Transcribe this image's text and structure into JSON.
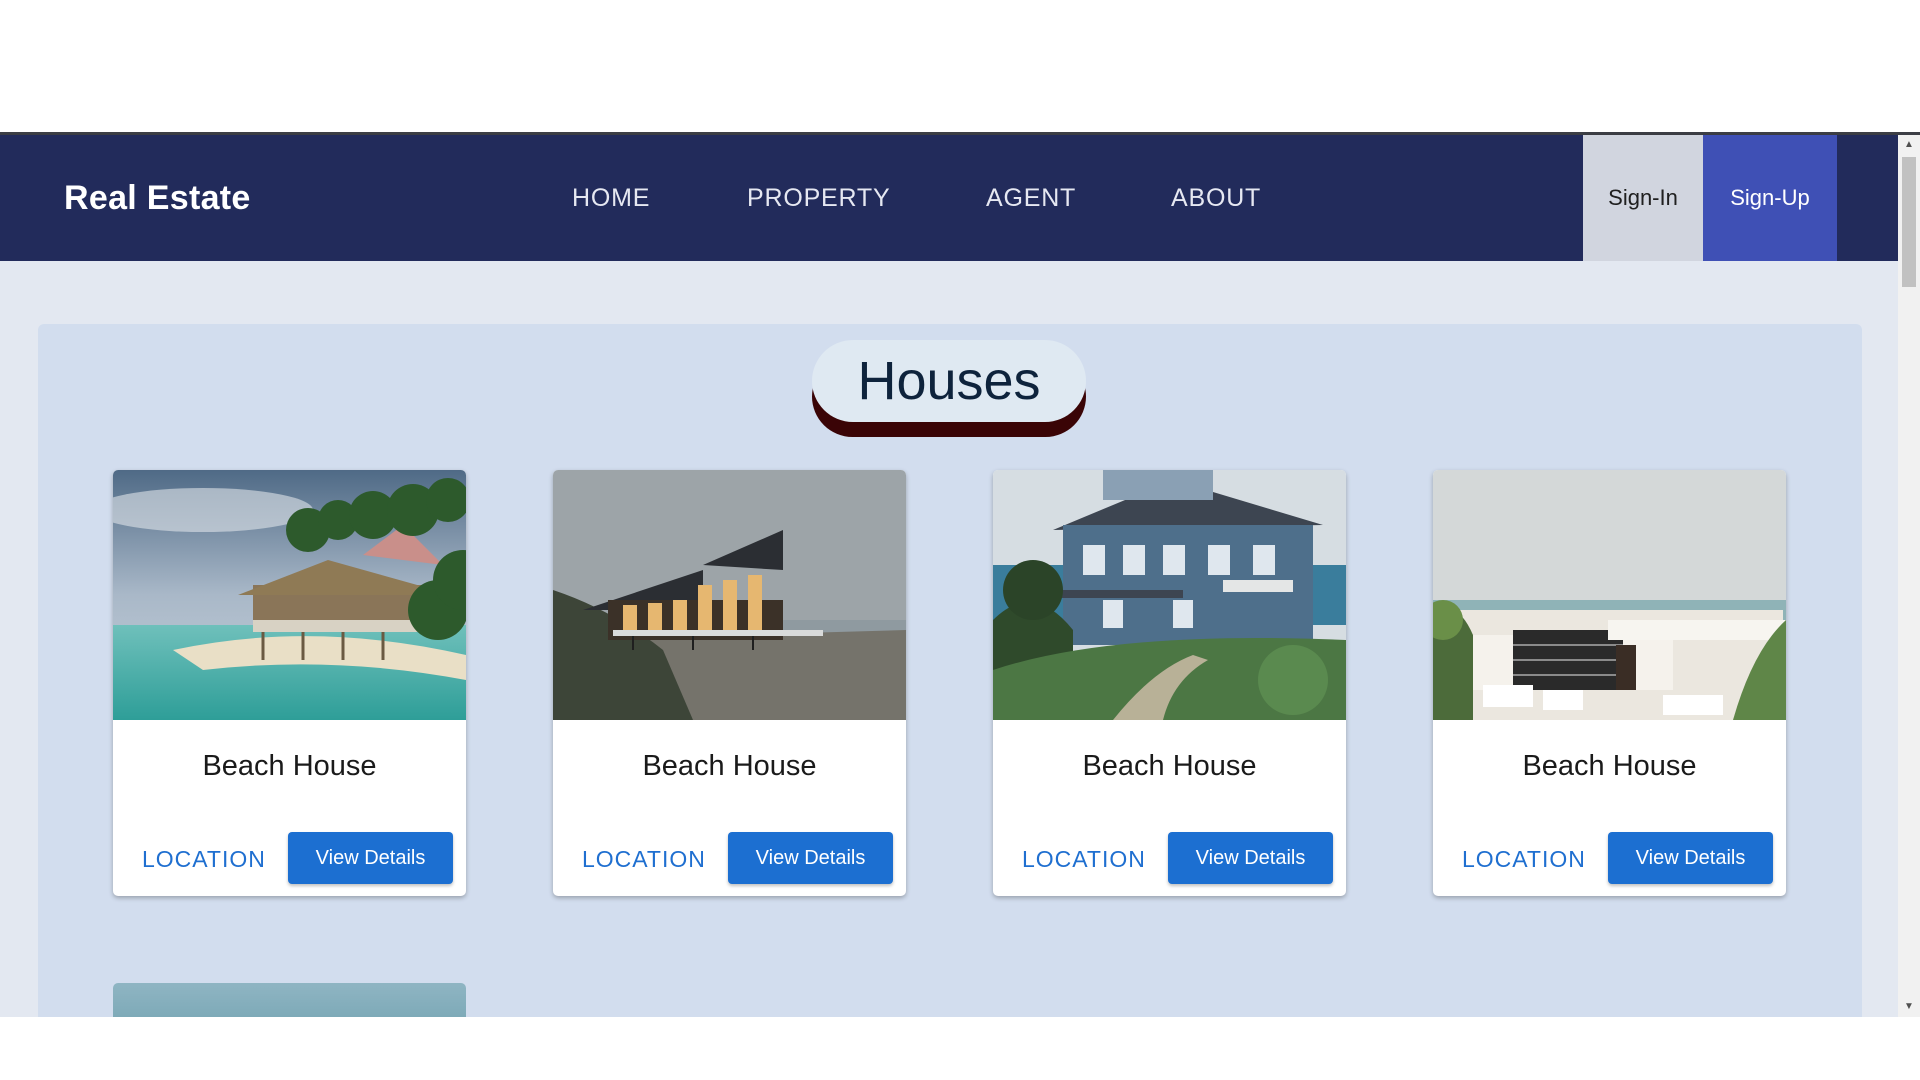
{
  "navbar": {
    "brand": "Real Estate",
    "links": [
      "HOME",
      "PROPERTY",
      "AGENT",
      "ABOUT"
    ],
    "sign_in": "Sign-In",
    "sign_up": "Sign-Up"
  },
  "section": {
    "title": "Houses"
  },
  "cards": [
    {
      "title": "Beach House",
      "location": "LOCATION",
      "button": "View Details",
      "image": "beach-hut-tropical"
    },
    {
      "title": "Beach House",
      "location": "LOCATION",
      "button": "View Details",
      "image": "modern-beach-house-dusk"
    },
    {
      "title": "Beach House",
      "location": "LOCATION",
      "button": "View Details",
      "image": "blue-wooden-beach-house"
    },
    {
      "title": "Beach House",
      "location": "LOCATION",
      "button": "View Details",
      "image": "white-modern-villa"
    }
  ],
  "colors": {
    "navbar": "#222b5b",
    "sign_in_bg": "#d1d5df",
    "sign_up_bg": "#3f50b5",
    "primary_button": "#1c6fd1",
    "panel": "#d2ddee",
    "pill_shadow": "#3a0406"
  },
  "icons": [
    "scroll-up-arrow-icon",
    "scroll-down-arrow-icon"
  ]
}
